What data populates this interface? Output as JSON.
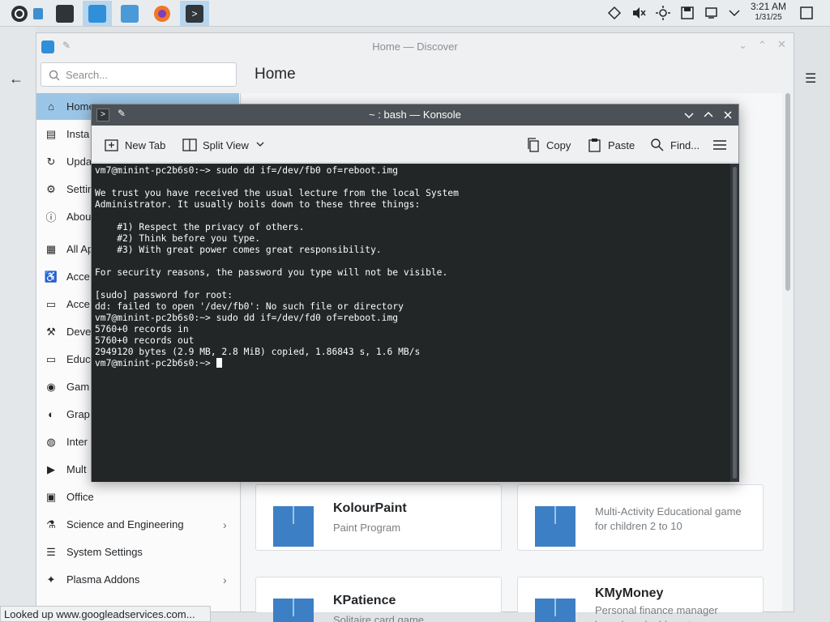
{
  "taskbar": {
    "apps": [
      {
        "name": "system-monitor"
      },
      {
        "name": "discover"
      },
      {
        "name": "dolphin"
      },
      {
        "name": "firefox"
      },
      {
        "name": "konsole"
      }
    ],
    "clock_time": "3:21 AM",
    "clock_date": "1/31/25"
  },
  "discover": {
    "window_title": "Home — Discover",
    "search_placeholder": "Search...",
    "page_title": "Home",
    "sidebar": [
      {
        "label": "Home",
        "icon": "home-icon"
      },
      {
        "label": "Insta",
        "icon": "installed-icon"
      },
      {
        "label": "Upda",
        "icon": "updates-icon"
      },
      {
        "label": "Settin",
        "icon": "settings-icon"
      },
      {
        "label": "Abou",
        "icon": "about-icon"
      },
      {
        "label": "All Ap",
        "icon": "grid-icon"
      },
      {
        "label": "Acce",
        "icon": "accessibility-icon"
      },
      {
        "label": "Acce",
        "icon": "accessories-icon"
      },
      {
        "label": "Deve",
        "icon": "develop-icon"
      },
      {
        "label": "Educ",
        "icon": "education-icon"
      },
      {
        "label": "Gam",
        "icon": "games-icon"
      },
      {
        "label": "Grap",
        "icon": "graphics-icon"
      },
      {
        "label": "Inter",
        "icon": "internet-icon"
      },
      {
        "label": "Mult",
        "icon": "multimedia-icon"
      },
      {
        "label": "Office",
        "icon": "office-icon"
      },
      {
        "label": "Science and Engineering",
        "icon": "science-icon"
      },
      {
        "label": "System Settings",
        "icon": "system-settings-icon"
      },
      {
        "label": "Plasma Addons",
        "icon": "plasma-addons-icon"
      }
    ],
    "cards": [
      {
        "name": "KolourPaint",
        "desc": "Paint Program"
      },
      {
        "name": "",
        "desc": "Multi-Activity Educational game for children 2 to 10"
      },
      {
        "name": "KPatience",
        "desc": "Solitaire card game"
      },
      {
        "name": "KMyMoney",
        "desc": "Personal finance manager based on double-entry bookkeeping"
      }
    ],
    "status_text": "Looked up www.googleadservices.com..."
  },
  "konsole": {
    "window_title": "~ : bash — Konsole",
    "toolbar": {
      "new_tab": "New Tab",
      "split_view": "Split View",
      "copy": "Copy",
      "paste": "Paste",
      "find": "Find..."
    },
    "terminal_lines": [
      "vm7@minint-pc2b6s0:~> sudo dd if=/dev/fb0 of=reboot.img",
      "",
      "We trust you have received the usual lecture from the local System",
      "Administrator. It usually boils down to these three things:",
      "",
      "    #1) Respect the privacy of others.",
      "    #2) Think before you type.",
      "    #3) With great power comes great responsibility.",
      "",
      "For security reasons, the password you type will not be visible.",
      "",
      "[sudo] password for root:",
      "dd: failed to open '/dev/fb0': No such file or directory",
      "vm7@minint-pc2b6s0:~> sudo dd if=/dev/fd0 of=reboot.img",
      "5760+0 records in",
      "5760+0 records out",
      "2949120 bytes (2.9 MB, 2.8 MiB) copied, 1.86843 s, 1.6 MB/s"
    ],
    "prompt": "vm7@minint-pc2b6s0:~> "
  }
}
